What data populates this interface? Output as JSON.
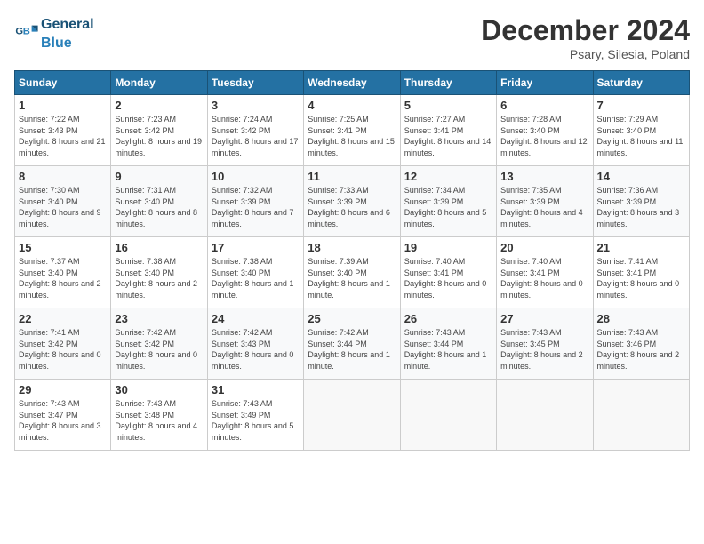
{
  "header": {
    "logo_general": "General",
    "logo_blue": "Blue",
    "month_title": "December 2024",
    "location": "Psary, Silesia, Poland"
  },
  "calendar": {
    "days_of_week": [
      "Sunday",
      "Monday",
      "Tuesday",
      "Wednesday",
      "Thursday",
      "Friday",
      "Saturday"
    ],
    "weeks": [
      [
        {
          "day": "1",
          "sunrise": "7:22 AM",
          "sunset": "3:43 PM",
          "daylight": "8 hours and 21 minutes."
        },
        {
          "day": "2",
          "sunrise": "7:23 AM",
          "sunset": "3:42 PM",
          "daylight": "8 hours and 19 minutes."
        },
        {
          "day": "3",
          "sunrise": "7:24 AM",
          "sunset": "3:42 PM",
          "daylight": "8 hours and 17 minutes."
        },
        {
          "day": "4",
          "sunrise": "7:25 AM",
          "sunset": "3:41 PM",
          "daylight": "8 hours and 15 minutes."
        },
        {
          "day": "5",
          "sunrise": "7:27 AM",
          "sunset": "3:41 PM",
          "daylight": "8 hours and 14 minutes."
        },
        {
          "day": "6",
          "sunrise": "7:28 AM",
          "sunset": "3:40 PM",
          "daylight": "8 hours and 12 minutes."
        },
        {
          "day": "7",
          "sunrise": "7:29 AM",
          "sunset": "3:40 PM",
          "daylight": "8 hours and 11 minutes."
        }
      ],
      [
        {
          "day": "8",
          "sunrise": "7:30 AM",
          "sunset": "3:40 PM",
          "daylight": "8 hours and 9 minutes."
        },
        {
          "day": "9",
          "sunrise": "7:31 AM",
          "sunset": "3:40 PM",
          "daylight": "8 hours and 8 minutes."
        },
        {
          "day": "10",
          "sunrise": "7:32 AM",
          "sunset": "3:39 PM",
          "daylight": "8 hours and 7 minutes."
        },
        {
          "day": "11",
          "sunrise": "7:33 AM",
          "sunset": "3:39 PM",
          "daylight": "8 hours and 6 minutes."
        },
        {
          "day": "12",
          "sunrise": "7:34 AM",
          "sunset": "3:39 PM",
          "daylight": "8 hours and 5 minutes."
        },
        {
          "day": "13",
          "sunrise": "7:35 AM",
          "sunset": "3:39 PM",
          "daylight": "8 hours and 4 minutes."
        },
        {
          "day": "14",
          "sunrise": "7:36 AM",
          "sunset": "3:39 PM",
          "daylight": "8 hours and 3 minutes."
        }
      ],
      [
        {
          "day": "15",
          "sunrise": "7:37 AM",
          "sunset": "3:40 PM",
          "daylight": "8 hours and 2 minutes."
        },
        {
          "day": "16",
          "sunrise": "7:38 AM",
          "sunset": "3:40 PM",
          "daylight": "8 hours and 2 minutes."
        },
        {
          "day": "17",
          "sunrise": "7:38 AM",
          "sunset": "3:40 PM",
          "daylight": "8 hours and 1 minute."
        },
        {
          "day": "18",
          "sunrise": "7:39 AM",
          "sunset": "3:40 PM",
          "daylight": "8 hours and 1 minute."
        },
        {
          "day": "19",
          "sunrise": "7:40 AM",
          "sunset": "3:41 PM",
          "daylight": "8 hours and 0 minutes."
        },
        {
          "day": "20",
          "sunrise": "7:40 AM",
          "sunset": "3:41 PM",
          "daylight": "8 hours and 0 minutes."
        },
        {
          "day": "21",
          "sunrise": "7:41 AM",
          "sunset": "3:41 PM",
          "daylight": "8 hours and 0 minutes."
        }
      ],
      [
        {
          "day": "22",
          "sunrise": "7:41 AM",
          "sunset": "3:42 PM",
          "daylight": "8 hours and 0 minutes."
        },
        {
          "day": "23",
          "sunrise": "7:42 AM",
          "sunset": "3:42 PM",
          "daylight": "8 hours and 0 minutes."
        },
        {
          "day": "24",
          "sunrise": "7:42 AM",
          "sunset": "3:43 PM",
          "daylight": "8 hours and 0 minutes."
        },
        {
          "day": "25",
          "sunrise": "7:42 AM",
          "sunset": "3:44 PM",
          "daylight": "8 hours and 1 minute."
        },
        {
          "day": "26",
          "sunrise": "7:43 AM",
          "sunset": "3:44 PM",
          "daylight": "8 hours and 1 minute."
        },
        {
          "day": "27",
          "sunrise": "7:43 AM",
          "sunset": "3:45 PM",
          "daylight": "8 hours and 2 minutes."
        },
        {
          "day": "28",
          "sunrise": "7:43 AM",
          "sunset": "3:46 PM",
          "daylight": "8 hours and 2 minutes."
        }
      ],
      [
        {
          "day": "29",
          "sunrise": "7:43 AM",
          "sunset": "3:47 PM",
          "daylight": "8 hours and 3 minutes."
        },
        {
          "day": "30",
          "sunrise": "7:43 AM",
          "sunset": "3:48 PM",
          "daylight": "8 hours and 4 minutes."
        },
        {
          "day": "31",
          "sunrise": "7:43 AM",
          "sunset": "3:49 PM",
          "daylight": "8 hours and 5 minutes."
        },
        null,
        null,
        null,
        null
      ]
    ]
  }
}
